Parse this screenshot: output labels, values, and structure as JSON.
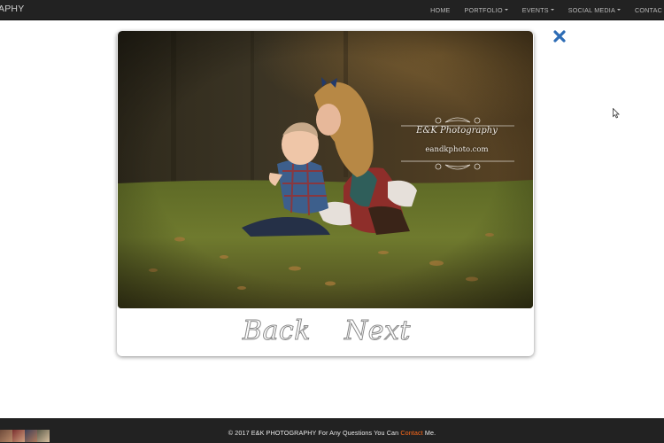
{
  "navbar": {
    "brand": "APHY",
    "items": [
      {
        "label": "HOME",
        "dropdown": false
      },
      {
        "label": "PORTFOLIO",
        "dropdown": true
      },
      {
        "label": "EVENTS",
        "dropdown": true
      },
      {
        "label": "SOCIAL MEDIA",
        "dropdown": true
      },
      {
        "label": "CONTAC",
        "dropdown": false
      }
    ]
  },
  "lightbox": {
    "watermark": {
      "name": "E&K Photography",
      "url": "eandkphoto.com"
    },
    "back_label": "Back",
    "next_label": "Next",
    "close_icon": "close-x-icon"
  },
  "footer": {
    "copyright_prefix": "© 2017 E&K PHOTOGRAPHY For Any Questions You Can ",
    "contact_link": "Contact",
    "copyright_suffix": " Me."
  },
  "colors": {
    "navbar_bg": "#222222",
    "nav_text": "#b9b9b9",
    "close_icon": "#2d6cb5",
    "contact_link": "#ff6a1a"
  }
}
